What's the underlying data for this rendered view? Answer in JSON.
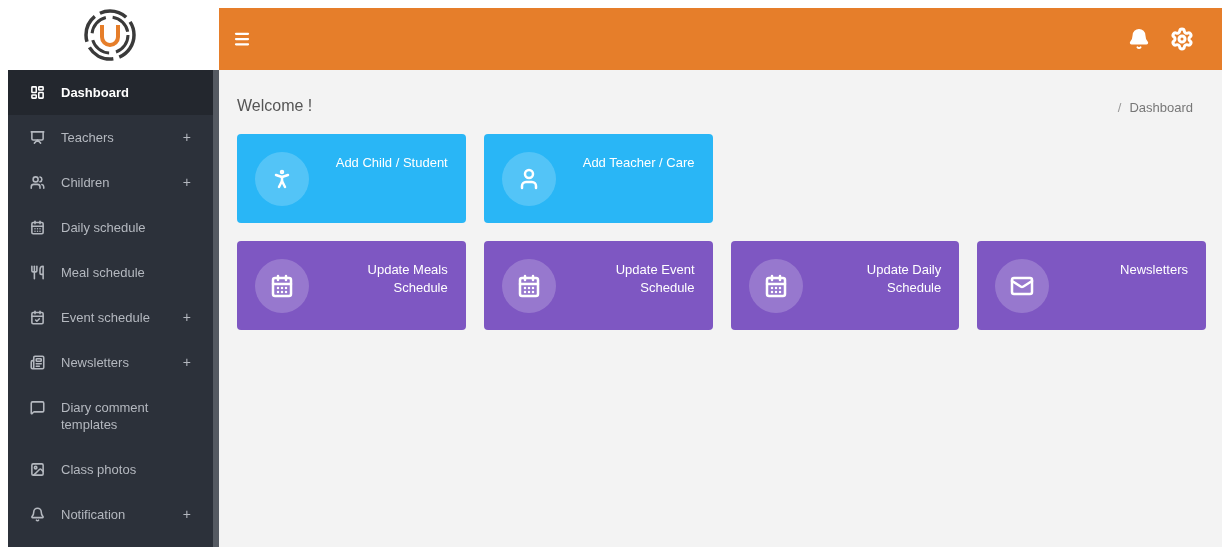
{
  "sidebar": {
    "items": [
      {
        "label": "Dashboard",
        "selected": true
      },
      {
        "label": "Teachers",
        "selected": false,
        "toggle": "+"
      },
      {
        "label": "Children",
        "selected": false,
        "toggle": "+"
      },
      {
        "label": "Daily schedule",
        "selected": false
      },
      {
        "label": "Meal schedule",
        "selected": false
      },
      {
        "label": "Event schedule",
        "selected": false,
        "toggle": "+"
      },
      {
        "label": "Newsletters",
        "selected": false,
        "toggle": "+"
      },
      {
        "label": "Diary comment templates",
        "selected": false
      },
      {
        "label": "Class photos",
        "selected": false
      },
      {
        "label": "Notification",
        "selected": false,
        "toggle": "+"
      }
    ]
  },
  "page": {
    "title": "Welcome !",
    "breadcrumb_separator": "/",
    "breadcrumb": "Dashboard"
  },
  "cards": [
    {
      "lines": [
        "Add Child / Student"
      ],
      "color": "#29b6f6"
    },
    {
      "lines": [
        "Add Teacher / Care"
      ],
      "color": "#29b6f6"
    },
    {
      "lines": [
        "Update Meals",
        "Schedule"
      ],
      "color": "#7e57c2"
    },
    {
      "lines": [
        "Update Event",
        "Schedule"
      ],
      "color": "#7e57c2"
    },
    {
      "lines": [
        "Update Daily",
        "Schedule"
      ],
      "color": "#7e57c2"
    },
    {
      "lines": [
        "Newsletters"
      ],
      "color": "#7e57c2"
    }
  ]
}
